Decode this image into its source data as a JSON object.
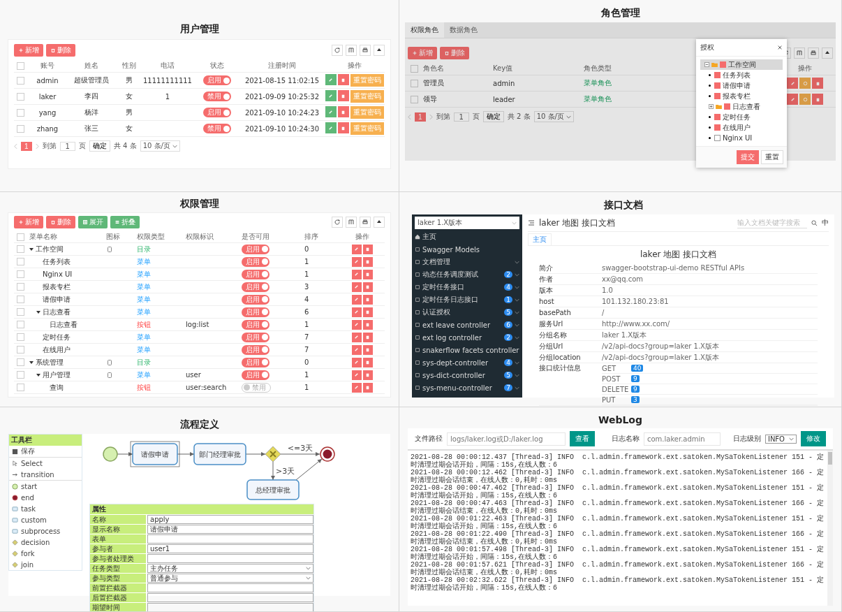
{
  "users": {
    "title": "用户管理",
    "toolbar": [
      {
        "label": "新增",
        "kind": "add"
      },
      {
        "label": "删除",
        "kind": "delete"
      }
    ],
    "columns": [
      "账号",
      "姓名",
      "性别",
      "电话",
      "状态",
      "注册时间",
      "操作"
    ],
    "all_checked": false,
    "rows": [
      {
        "checked": false,
        "account": "admin",
        "name": "超级管理员",
        "gender": "男",
        "phone": "11111111111",
        "status": "启用",
        "on": true,
        "created": "2021-08-15 11:02:15",
        "action": "重置密码"
      },
      {
        "checked": false,
        "account": "laker",
        "name": "李四",
        "gender": "女",
        "phone": "1",
        "status": "禁用",
        "on": true,
        "created": "2021-09-09 10:25:32",
        "action": "重置密码"
      },
      {
        "checked": false,
        "account": "yang",
        "name": "杨洋",
        "gender": "男",
        "status": "启用",
        "on": true,
        "created": "2021-09-10 10:24:23",
        "action": "重置密码"
      },
      {
        "checked": false,
        "account": "zhang",
        "name": "张三",
        "gender": "女",
        "status": "禁用",
        "on": true,
        "created": "2021-09-10 10:24:30",
        "action": "重置密码"
      }
    ],
    "pagination": {
      "page": "1",
      "goto": "到第",
      "page_input": "1",
      "page_unit": "页",
      "confirm": "确定",
      "total": "共 4 条",
      "per_page": "10 条/页"
    }
  },
  "roles": {
    "title": "角色管理",
    "tabs": [
      {
        "label": "权限角色",
        "selected": true
      },
      {
        "label": "数据角色",
        "selected": false
      }
    ],
    "toolbar": [
      {
        "label": "新增",
        "kind": "add"
      },
      {
        "label": "删除",
        "kind": "delete"
      }
    ],
    "columns": [
      "角色名",
      "Key值",
      "角色类型",
      "操作"
    ],
    "all_checked": false,
    "rows": [
      {
        "checked": false,
        "name": "管理员",
        "key": "admin",
        "type": "菜单角色"
      },
      {
        "checked": false,
        "name": "领导",
        "key": "leader",
        "type": "菜单角色"
      }
    ],
    "pagination": {
      "page": "1",
      "goto": "到第",
      "page_input": "1",
      "page_unit": "页",
      "confirm": "确定",
      "total": "共 2 条",
      "per_page": "10 条/页"
    },
    "dialog": {
      "title": "授权",
      "buttons": [
        {
          "label": "提交",
          "kind": "primary"
        },
        {
          "label": "重置",
          "kind": "plain"
        }
      ],
      "tree": [
        {
          "label": "工作空间",
          "kind": "folder",
          "checked": true,
          "expanded": true,
          "selected": true,
          "children": [
            {
              "label": "任务列表",
              "kind": "leaf",
              "checked": true,
              "selected": false
            },
            {
              "label": "请假申请",
              "kind": "leaf",
              "checked": true,
              "selected": false
            },
            {
              "label": "报表专栏",
              "kind": "leaf",
              "checked": true,
              "selected": false
            },
            {
              "label": "日志查看",
              "kind": "folder",
              "checked": true,
              "expanded": false,
              "selected": false
            },
            {
              "label": "定时任务",
              "kind": "leaf",
              "checked": true,
              "selected": false
            },
            {
              "label": "在线用户",
              "kind": "leaf",
              "checked": true,
              "selected": false
            },
            {
              "label": "Nginx UI",
              "kind": "leaf",
              "checked": false,
              "selected": false
            }
          ]
        }
      ]
    }
  },
  "menus": {
    "title": "权限管理",
    "toolbar": [
      {
        "label": "新增",
        "kind": "add"
      },
      {
        "label": "删除",
        "kind": "delete"
      },
      {
        "label": "展开",
        "kind": "expand"
      },
      {
        "label": "折叠",
        "kind": "collapse"
      }
    ],
    "columns": [
      "菜单名称",
      "图标",
      "权限类型",
      "权限标识",
      "是否可用",
      "排序",
      "操作"
    ],
    "all_checked": false,
    "rows": [
      {
        "checked": false,
        "name": "工作空间",
        "icon": true,
        "type": "目录",
        "kind": "directory",
        "status": "启用",
        "on": true,
        "order": "0",
        "expanded": true,
        "children": [
          {
            "checked": false,
            "name": "任务列表",
            "type": "菜单",
            "kind": "menu",
            "status": "启用",
            "on": true,
            "order": "1"
          },
          {
            "checked": false,
            "name": "Nginx UI",
            "type": "菜单",
            "kind": "menu",
            "status": "启用",
            "on": true,
            "order": "1"
          },
          {
            "checked": false,
            "name": "报表专栏",
            "type": "菜单",
            "kind": "menu",
            "status": "启用",
            "on": true,
            "order": "3"
          },
          {
            "checked": false,
            "name": "请假申请",
            "type": "菜单",
            "kind": "menu",
            "status": "启用",
            "on": true,
            "order": "4"
          },
          {
            "checked": false,
            "name": "日志查看",
            "type": "菜单",
            "kind": "menu",
            "status": "启用",
            "on": true,
            "order": "6",
            "expanded": true,
            "children": [
              {
                "checked": false,
                "name": "日志查看",
                "type": "按钮",
                "kind": "button",
                "perm": "log:list",
                "status": "启用",
                "on": true,
                "order": "1"
              }
            ]
          },
          {
            "checked": false,
            "name": "定时任务",
            "type": "菜单",
            "kind": "menu",
            "status": "启用",
            "on": true,
            "order": "7"
          },
          {
            "checked": false,
            "name": "在线用户",
            "type": "菜单",
            "kind": "menu",
            "status": "启用",
            "on": true,
            "order": "7"
          }
        ]
      },
      {
        "checked": false,
        "name": "系统管理",
        "icon": true,
        "type": "目录",
        "kind": "directory",
        "status": "启用",
        "on": true,
        "order": "0",
        "expanded": true,
        "children": [
          {
            "checked": false,
            "name": "用户管理",
            "icon": true,
            "type": "菜单",
            "kind": "menu",
            "perm": "user",
            "status": "启用",
            "on": true,
            "order": "1",
            "expanded": true,
            "children": [
              {
                "checked": false,
                "name": "查询",
                "type": "按钮",
                "kind": "button",
                "perm": "user:search",
                "status": "禁用",
                "on": false,
                "order": "1"
              }
            ]
          }
        ]
      }
    ]
  },
  "docs": {
    "title": "接口文档",
    "group_select": "laker 1.X版本",
    "sidebar": [
      {
        "label": "主页",
        "kind": "home"
      },
      {
        "label": "Swagger Models",
        "kind": "page"
      },
      {
        "label": "文档管理",
        "kind": "group"
      },
      {
        "label": "动态任务调度测试",
        "kind": "group",
        "badge": "2"
      },
      {
        "label": "定时任务接口",
        "kind": "group",
        "badge": "4"
      },
      {
        "label": "定时任务日志接口",
        "kind": "group",
        "badge": "1"
      },
      {
        "label": "认证授权",
        "kind": "group",
        "badge": "5"
      },
      {
        "label": "ext leave controller",
        "kind": "group",
        "badge": "6"
      },
      {
        "label": "ext log controller",
        "kind": "group",
        "badge": "2"
      },
      {
        "label": "snakerflow facets controller",
        "kind": "page"
      },
      {
        "label": "sys-dept-controller",
        "kind": "group",
        "badge": "4"
      },
      {
        "label": "sys-dict-controller",
        "kind": "group",
        "badge": "5"
      },
      {
        "label": "sys-menu-controller",
        "kind": "group",
        "badge": "7"
      }
    ],
    "header_title": "laker 地图 接口文档",
    "search_placeholder": "输入文档关键字搜索",
    "language": "中",
    "tab": "主页",
    "heading": "laker 地图 接口文档",
    "info": [
      {
        "label": "简介",
        "value": "swagger-bootstrap-ui-demo RESTful APIs"
      },
      {
        "label": "作者",
        "value": "xx@qq.com"
      },
      {
        "label": "版本",
        "value": "1.0"
      },
      {
        "label": "host",
        "value": "101.132.180.23:81"
      },
      {
        "label": "basePath",
        "value": "/"
      },
      {
        "label": "服务Url",
        "value": "http://www.xx.com/"
      },
      {
        "label": "分组名称",
        "value": "laker 1.X版本"
      },
      {
        "label": "分组Url",
        "value": "/v2/api-docs?group=laker 1.X版本"
      },
      {
        "label": "分组location",
        "value": "/v2/api-docs?group=laker 1.X版本"
      }
    ],
    "stats_label": "接口统计信息",
    "stats": [
      {
        "method": "GET",
        "count": "40"
      },
      {
        "method": "POST",
        "count": "9"
      },
      {
        "method": "DELETE",
        "count": "9"
      },
      {
        "method": "PUT",
        "count": "3"
      }
    ]
  },
  "flow": {
    "title": "流程定义",
    "palette_title": "工具栏",
    "palette": [
      {
        "label": "保存",
        "kind": "save"
      },
      {
        "label": "Select",
        "kind": "select"
      },
      {
        "label": "transition",
        "kind": "transition"
      },
      {
        "label": "start",
        "kind": "start"
      },
      {
        "label": "end",
        "kind": "end"
      },
      {
        "label": "task",
        "kind": "task"
      },
      {
        "label": "custom",
        "kind": "custom"
      },
      {
        "label": "subprocess",
        "kind": "subprocess"
      },
      {
        "label": "decision",
        "kind": "decision"
      },
      {
        "label": "fork",
        "kind": "fork"
      },
      {
        "label": "join",
        "kind": "join"
      }
    ],
    "nodes": [
      {
        "kind": "start",
        "selected": false
      },
      {
        "kind": "task",
        "label": "请假申请",
        "selected": true
      },
      {
        "kind": "task",
        "label": "部门经理审批",
        "selected": false
      },
      {
        "kind": "decision",
        "selected": false
      },
      {
        "kind": "end",
        "selected": false
      },
      {
        "kind": "task",
        "label": "总经理审批",
        "selected": false
      }
    ],
    "edge_labels": [
      "<=3天",
      ">3天"
    ],
    "properties_title": "属性",
    "properties": [
      {
        "label": "名称",
        "kind": "input",
        "value": "apply"
      },
      {
        "label": "显示名称",
        "kind": "input",
        "value": "请假申请"
      },
      {
        "label": "表单",
        "kind": "input"
      },
      {
        "label": "参与者",
        "kind": "input",
        "value": "user1"
      },
      {
        "label": "参与者处理类",
        "kind": "input"
      },
      {
        "label": "任务类型",
        "kind": "select",
        "value": "主办任务"
      },
      {
        "label": "参与类型",
        "kind": "select",
        "value": "普通参与"
      },
      {
        "label": "前置拦截器",
        "kind": "input"
      },
      {
        "label": "后置拦截器",
        "kind": "input"
      },
      {
        "label": "期望时间",
        "kind": "input"
      }
    ]
  },
  "weblog": {
    "title": "WebLog",
    "file_label": "文件路径",
    "file_placeholder": "logs/laker.log或D:/laker.log",
    "view_button": "查看",
    "name_label": "日志名称",
    "name_placeholder": "com.laker.admin",
    "level_label": "日志级别",
    "level": "INFO",
    "modify_button": "修改",
    "lines": [
      "2021-08-28 00:00:12.437 [Thread-3] INFO  c.l.admin.framework.ext.satoken.MySaTokenListener 151 - 定时清理过期会话开始，间隔：15s,在线人数：6",
      "2021-08-28 00:00:12.462 [Thread-3] INFO  c.l.admin.framework.ext.satoken.MySaTokenListener 166 - 定时清理过期会话结束，在线人数：0,耗时：0ms",
      "2021-08-28 00:00:47.462 [Thread-3] INFO  c.l.admin.framework.ext.satoken.MySaTokenListener 151 - 定时清理过期会话开始，间隔：15s,在线人数：6",
      "2021-08-28 00:00:47.463 [Thread-3] INFO  c.l.admin.framework.ext.satoken.MySaTokenListener 166 - 定时清理过期会话结束，在线人数：0,耗时：0ms",
      "2021-08-28 00:01:22.463 [Thread-3] INFO  c.l.admin.framework.ext.satoken.MySaTokenListener 151 - 定时清理过期会话开始，间隔：15s,在线人数：6",
      "2021-08-28 00:01:22.490 [Thread-3] INFO  c.l.admin.framework.ext.satoken.MySaTokenListener 166 - 定时清理过期会话结束，在线人数：0,耗时：0ms",
      "2021-08-28 00:01:57.498 [Thread-3] INFO  c.l.admin.framework.ext.satoken.MySaTokenListener 151 - 定时清理过期会话开始，间隔：15s,在线人数：6",
      "2021-08-28 00:01:57.621 [Thread-3] INFO  c.l.admin.framework.ext.satoken.MySaTokenListener 166 - 定时清理过期会话结束，在线人数：0,耗时：0ms",
      "2021-08-28 00:02:32.622 [Thread-3] INFO  c.l.admin.framework.ext.satoken.MySaTokenListener 151 - 定时清理过期会话开始，间隔：15s,在线人数：6"
    ]
  }
}
